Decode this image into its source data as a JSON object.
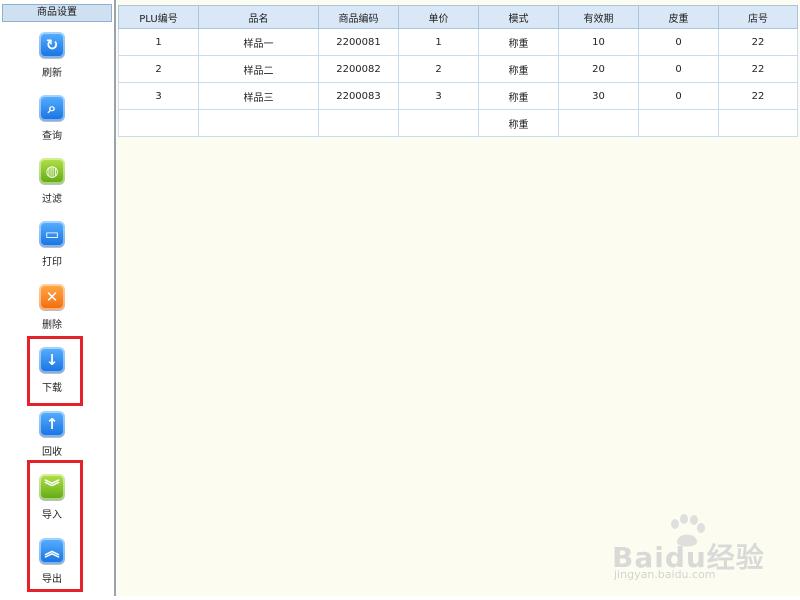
{
  "sidebar": {
    "title": "商品设置",
    "tools": [
      {
        "label": "刷新",
        "icon": "refresh-icon",
        "glyph": "↻",
        "color": "#1e7ff0"
      },
      {
        "label": "查询",
        "icon": "search-icon",
        "glyph": "⌕",
        "color": "#1e7ff0"
      },
      {
        "label": "过滤",
        "icon": "filter-icon",
        "glyph": "◍",
        "color": "#6cb41c"
      },
      {
        "label": "打印",
        "icon": "print-icon",
        "glyph": "▭",
        "color": "#1e7ff0"
      },
      {
        "label": "删除",
        "icon": "delete-icon",
        "glyph": "✕",
        "color": "#f27a14"
      },
      {
        "label": "下载",
        "icon": "download-icon",
        "glyph": "↓",
        "color": "#1e7ff0"
      },
      {
        "label": "回收",
        "icon": "upload-icon",
        "glyph": "↑",
        "color": "#1e7ff0"
      },
      {
        "label": "导入",
        "icon": "import-icon",
        "glyph": "︾",
        "color": "#6cb41c"
      },
      {
        "label": "导出",
        "icon": "export-icon",
        "glyph": "︽",
        "color": "#1e7ff0"
      }
    ]
  },
  "table": {
    "columns": [
      "PLU编号",
      "品名",
      "商品编码",
      "单价",
      "模式",
      "有效期",
      "皮重",
      "店号"
    ],
    "rows": [
      [
        "1",
        "样品一",
        "2200081",
        "1",
        "称重",
        "10",
        "0",
        "22"
      ],
      [
        "2",
        "样品二",
        "2200082",
        "2",
        "称重",
        "20",
        "0",
        "22"
      ],
      [
        "3",
        "样品三",
        "2200083",
        "3",
        "称重",
        "30",
        "0",
        "22"
      ],
      [
        "",
        "",
        "",
        "",
        "称重",
        "",
        "",
        ""
      ]
    ]
  },
  "watermark": {
    "brand": "Baidu经验",
    "url": "jingyan.baidu.com"
  },
  "colors": {
    "highlight": "#e4222c",
    "main_bg": "#fcfdf0",
    "header_bg": "#d9e7f6"
  }
}
